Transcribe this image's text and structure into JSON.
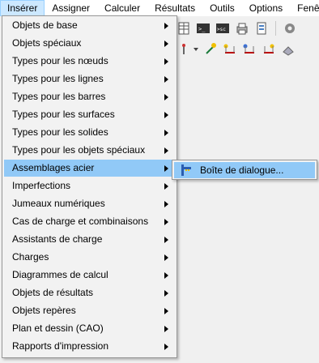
{
  "menubar": {
    "items": [
      "Insérer",
      "Assigner",
      "Calculer",
      "Résultats",
      "Outils",
      "Options",
      "Fenêtre"
    ]
  },
  "insert_menu": {
    "items": [
      {
        "label": "Objets de base",
        "has_submenu": true
      },
      {
        "label": "Objets spéciaux",
        "has_submenu": true
      },
      {
        "label": "Types pour les nœuds",
        "has_submenu": true
      },
      {
        "label": "Types pour les lignes",
        "has_submenu": true
      },
      {
        "label": "Types pour les barres",
        "has_submenu": true
      },
      {
        "label": "Types pour les surfaces",
        "has_submenu": true
      },
      {
        "label": "Types pour les solides",
        "has_submenu": true
      },
      {
        "label": "Types pour les objets spéciaux",
        "has_submenu": true
      },
      {
        "label": "Assemblages acier",
        "has_submenu": true,
        "highlighted": true
      },
      {
        "label": "Imperfections",
        "has_submenu": true
      },
      {
        "label": "Jumeaux numériques",
        "has_submenu": true
      },
      {
        "label": "Cas de charge et combinaisons",
        "has_submenu": true
      },
      {
        "label": "Assistants de charge",
        "has_submenu": true
      },
      {
        "label": "Charges",
        "has_submenu": true
      },
      {
        "label": "Diagrammes de calcul",
        "has_submenu": true
      },
      {
        "label": "Objets de résultats",
        "has_submenu": true
      },
      {
        "label": "Objets repères",
        "has_submenu": true
      },
      {
        "label": "Plan et dessin (CAO)",
        "has_submenu": true
      },
      {
        "label": "Rapports d'impression",
        "has_submenu": true
      }
    ]
  },
  "submenu": {
    "item_label": "Boîte de dialogue...",
    "item_icon": "steel-joint-dialog-icon"
  },
  "colors": {
    "highlight": "#91c9f7",
    "menubar_active": "#cce8ff",
    "menu_bg": "#f2f2f2"
  }
}
